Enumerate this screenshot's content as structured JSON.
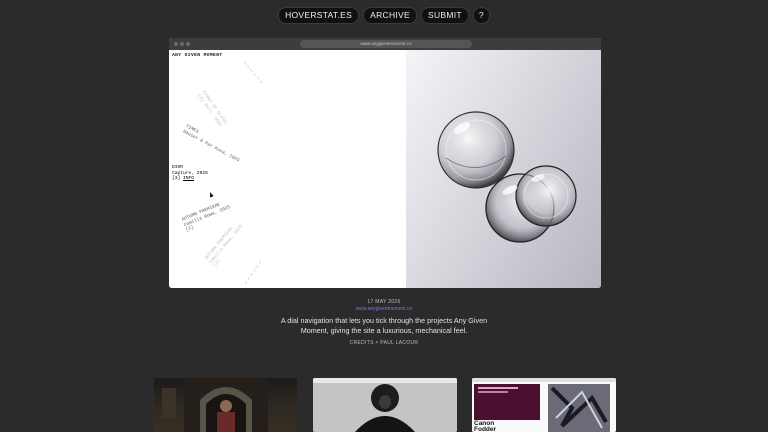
{
  "nav": {
    "brand": "HOVERSTAT.ES",
    "archive": "ARCHIVE",
    "submit": "SUBMIT",
    "help": "?"
  },
  "browser": {
    "url": "www.anygivenmoment.co"
  },
  "site": {
    "logo": "ANY GIVEN MOMENT",
    "dial_items": [
      {
        "l1": "RINGS OF GLASS,",
        "l2": "[3] Hall, 2025"
      },
      {
        "l1": "TIMES",
        "l2": "Hauser & Par Kuna, 2025"
      },
      {
        "l1": "DIOR",
        "l2": "Capture, 2025",
        "l3_a": "[3] ",
        "l3_b": "INFO"
      },
      {
        "l1": "AUTUMN PREMIERE",
        "l2": "Camilla Rowe, 2025",
        "l3": "[3]"
      },
      {
        "l1": "AUTUMN PREMIERE",
        "l2": "Camilla Rowe, 2025",
        "l3": "[3]"
      }
    ]
  },
  "caption": {
    "date": "17 MAY 2026",
    "link": "www.anygivenmoment.co",
    "description": "A dial navigation that lets you tick through the projects Any Given Moment, giving the site a luxurious, mechanical feel.",
    "credits": "CREDITS × PAUL LACOUR"
  },
  "thumbs": {
    "third_title_1": "Canon",
    "third_title_2": "Fodder"
  },
  "colors": {
    "background": "#2b2b2b",
    "pill": "#111111",
    "link": "#7b78e6"
  }
}
